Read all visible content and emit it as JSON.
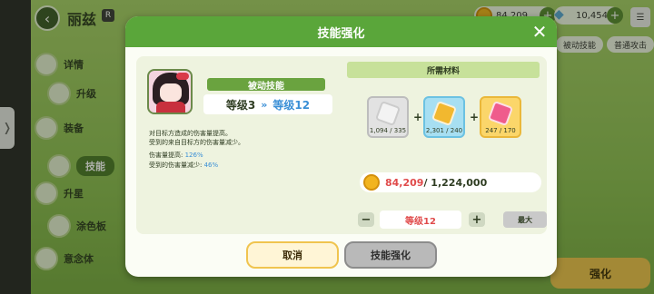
{
  "background": {
    "character_name": "丽兹",
    "character_badge": "R",
    "gold": "84,209",
    "gems": "10,454",
    "tabs": [
      "被动技能",
      "普通攻击"
    ],
    "side_menu": [
      {
        "label": "详情",
        "icon": "info-icon"
      },
      {
        "label": "升级",
        "icon": "level-up-icon"
      },
      {
        "label": "装备",
        "icon": "equipment-icon"
      },
      {
        "label": "技能",
        "icon": "skill-icon",
        "active": true
      },
      {
        "label": "升星",
        "icon": "star-icon"
      },
      {
        "label": "涂色板",
        "icon": "palette-icon"
      },
      {
        "label": "意念体",
        "icon": "spirit-icon"
      }
    ],
    "bottom_button": "强化"
  },
  "modal": {
    "title": "技能强化",
    "skill_type": "被动技能",
    "level_from": "等级3",
    "level_arrow": "»",
    "level_to": "等级12",
    "description_line1": "对目标方造成的伤害量提高。",
    "description_line2": "受到的来自目标方的伤害量减少。",
    "stat1_label": "伤害量提高:",
    "stat1_value": "126%",
    "stat2_label": "受到的伤害量减少:",
    "stat2_value": "46%",
    "materials_header": "所需材料",
    "materials": [
      {
        "count": "1,094 / 335",
        "rarity": "common"
      },
      {
        "count": "2,301 / 240",
        "rarity": "rare"
      },
      {
        "count": "247 / 170",
        "rarity": "epic"
      }
    ],
    "cost_have": "84,209",
    "cost_need": " / 1,224,000",
    "target_level": "等级12",
    "max_label": "最大",
    "cancel_label": "取消",
    "upgrade_label": "技能强化"
  },
  "colors": {
    "header_green": "#5aa63a",
    "accent_blue": "#3a8fd6",
    "insufficient_red": "#e04b4b",
    "cancel_yellow": "#f0c44f"
  }
}
